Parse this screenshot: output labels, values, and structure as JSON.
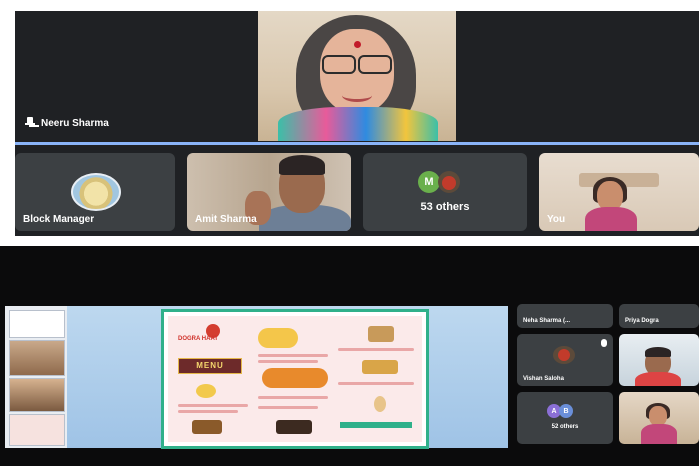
{
  "top_screenshot": {
    "speaker": {
      "name": "Neeru Sharma"
    },
    "tiles": [
      {
        "label": "Block Manager"
      },
      {
        "label": "Amit Sharma"
      },
      {
        "label": "53 others",
        "avatar_letter": "M"
      },
      {
        "label": "You"
      }
    ]
  },
  "bottom_screenshot": {
    "slide": {
      "title": "DOGRA HAAT",
      "menu_banner": "MENU"
    },
    "participants": [
      {
        "label": "Neha Sharma (..."
      },
      {
        "label": "Priya Dogra"
      },
      {
        "label": "Vishan Saloha"
      },
      {
        "label": "52 others",
        "avatar_letters": [
          "A",
          "B"
        ]
      }
    ]
  },
  "colors": {
    "meet_background": "#1f2124",
    "tile_background": "#3c4043",
    "active_speaker_strip": "#8ab4f8",
    "slide_border": "#2fb08a",
    "menu_banner": "#6d2a2a"
  }
}
